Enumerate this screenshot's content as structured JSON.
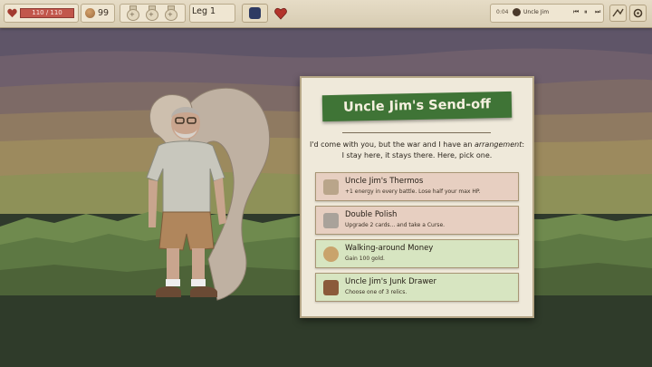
{
  "hud": {
    "hp_text": "110 / 110",
    "hp_fraction": 1.0,
    "gold": "99",
    "leg_label": "Leg 1",
    "potion_slots": [
      "+",
      "+",
      "+"
    ]
  },
  "music": {
    "time": "0:04",
    "track": "Uncle Jim",
    "controls": [
      "⏮",
      "⏸",
      "⏭"
    ]
  },
  "dialog": {
    "title": "Uncle Jim's Send-off",
    "body_line1_prefix": "I'd come with you, but the war and I have an ",
    "body_line1_em": "arrangement",
    "body_line1_suffix": ":",
    "body_line2": "I stay here, it stays there. Here, pick one.",
    "options": [
      {
        "title": "Uncle Jim's Thermos",
        "desc": "+1 energy in every battle. Lose half your max HP.",
        "tone": "red",
        "icon": "thermos-icon"
      },
      {
        "title": "Double Polish",
        "desc": "Upgrade 2 cards... and take a Curse.",
        "tone": "red",
        "icon": "polish-icon"
      },
      {
        "title": "Walking-around Money",
        "desc": "Gain 100 gold.",
        "tone": "green",
        "icon": "money-icon"
      },
      {
        "title": "Uncle Jim's Junk Drawer",
        "desc": "Choose one of 3 relics.",
        "tone": "green",
        "icon": "drawer-icon"
      }
    ]
  },
  "colors": {
    "accent_green": "#3f7436",
    "hp_red": "#c2574c"
  }
}
